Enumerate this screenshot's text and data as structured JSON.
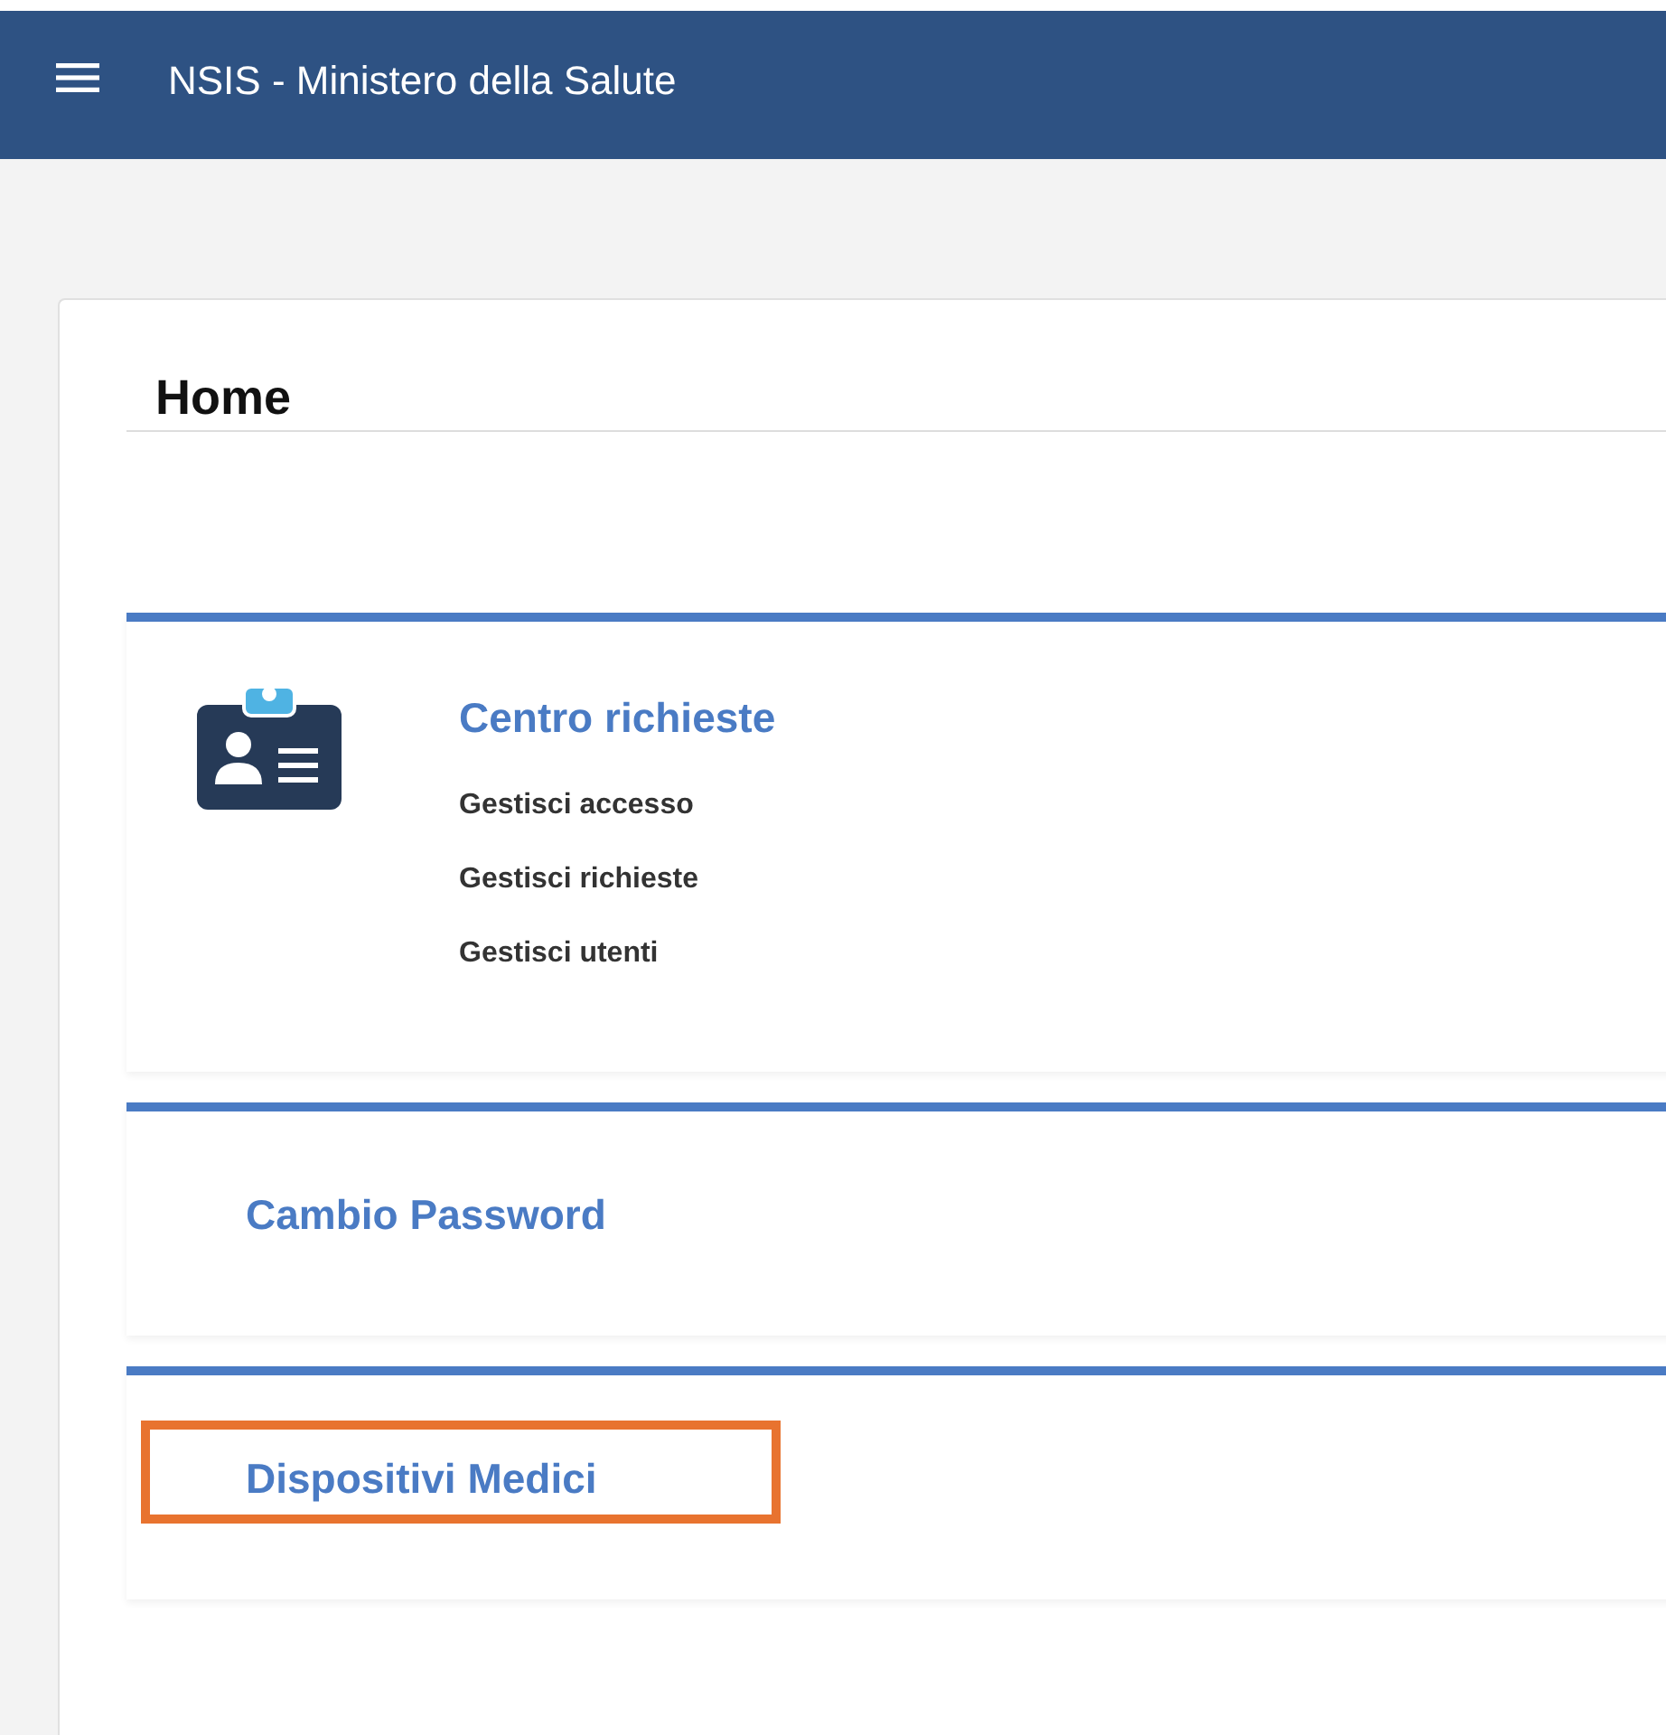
{
  "header": {
    "title": "NSIS - Ministero della Salute"
  },
  "page": {
    "title": "Home"
  },
  "tiles": [
    {
      "kind": "links",
      "title": "Centro richieste",
      "links": [
        "Gestisci accesso",
        "Gestisci richieste",
        "Gestisci utenti"
      ],
      "highlighted": false
    },
    {
      "kind": "simple",
      "title": "Cambio Password",
      "highlighted": false
    },
    {
      "kind": "simple",
      "title": "Dispositivi Medici",
      "highlighted": true
    }
  ]
}
